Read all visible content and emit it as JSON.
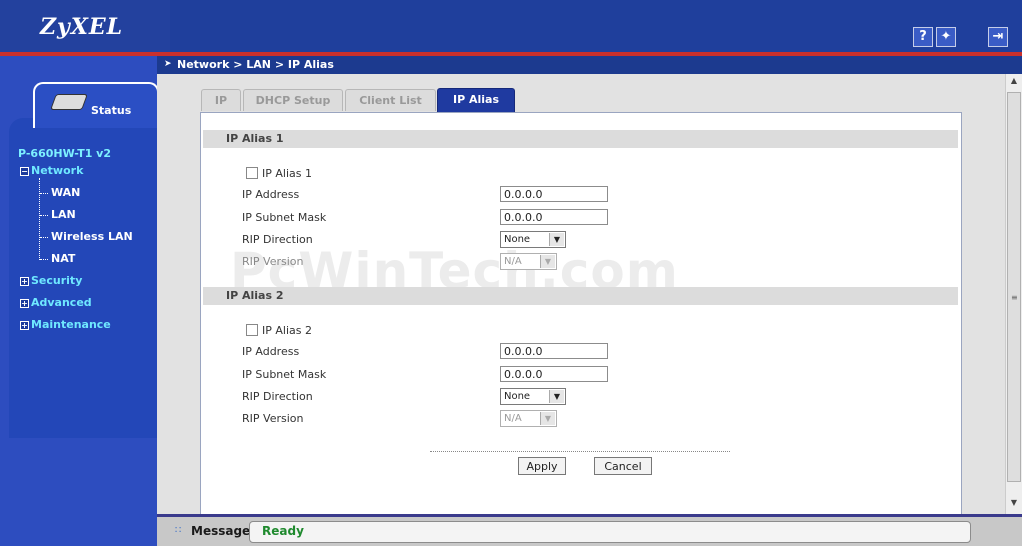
{
  "header": {
    "logo": "ZyXEL",
    "help_icon": "?",
    "wizard_icon": "✦",
    "logout_icon": "⇥"
  },
  "breadcrumb": "Network > LAN > IP Alias",
  "sidebar": {
    "status_tab": "Status",
    "model": "P-660HW-T1 v2",
    "network": "Network",
    "network_items": [
      "WAN",
      "LAN",
      "Wireless LAN",
      "NAT"
    ],
    "security": "Security",
    "advanced": "Advanced",
    "maintenance": "Maintenance"
  },
  "tabs": [
    "IP",
    "DHCP Setup",
    "Client List",
    "IP Alias"
  ],
  "alias1": {
    "title": "IP Alias 1",
    "checkbox_label": "IP Alias 1",
    "ip_label": "IP Address",
    "ip_value": "0.0.0.0",
    "mask_label": "IP Subnet Mask",
    "mask_value": "0.0.0.0",
    "rip_dir_label": "RIP Direction",
    "rip_dir_value": "None",
    "rip_ver_label": "RIP Version",
    "rip_ver_value": "N/A"
  },
  "alias2": {
    "title": "IP Alias 2",
    "checkbox_label": "IP Alias 2",
    "ip_label": "IP Address",
    "ip_value": "0.0.0.0",
    "mask_label": "IP Subnet Mask",
    "mask_value": "0.0.0.0",
    "rip_dir_label": "RIP Direction",
    "rip_dir_value": "None",
    "rip_ver_label": "RIP Version",
    "rip_ver_value": "N/A"
  },
  "buttons": {
    "apply": "Apply",
    "cancel": "Cancel"
  },
  "watermark": "PcWinTech.com",
  "message": {
    "label": "Message",
    "text": "Ready"
  }
}
